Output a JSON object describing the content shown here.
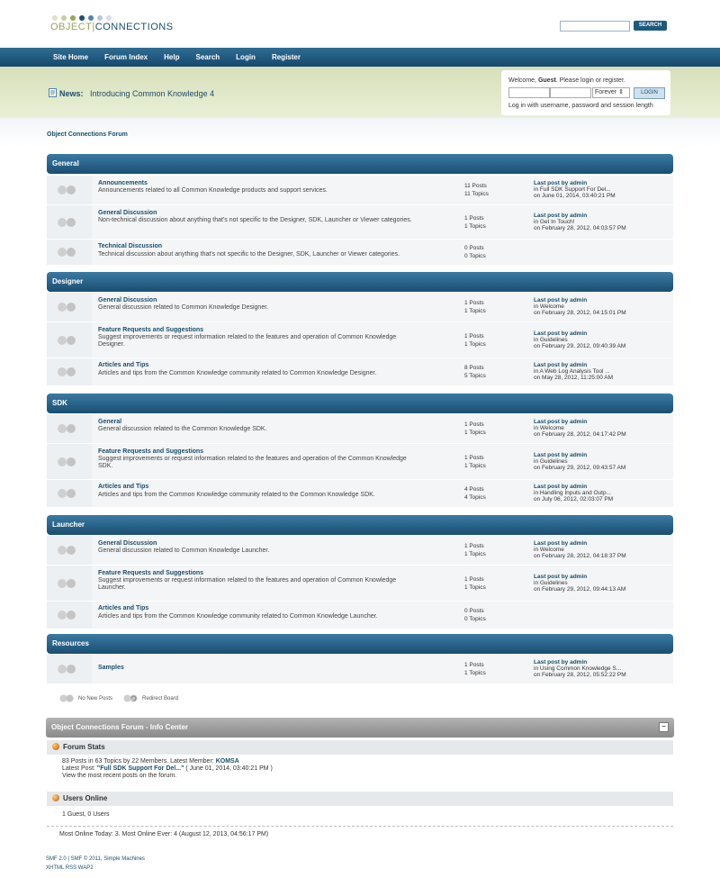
{
  "header": {
    "logo_part1": "OBJECT",
    "logo_sep": "|",
    "logo_part2": "CONNECTIONS",
    "logo_dot_colors": [
      "#dfe0c6",
      "#c8cda0",
      "#9aa45a",
      "#1b4d6b",
      "#4f86a8",
      "#b7c9d6",
      "#d6dee6"
    ],
    "search_value": "",
    "search_button": "SEARCH"
  },
  "nav": [
    "Site Home",
    "Forum Index",
    "Help",
    "Search",
    "Login",
    "Register"
  ],
  "news": {
    "label": "News:",
    "text": "Introducing Common Knowledge 4"
  },
  "login": {
    "welcome_prefix": "Welcome,",
    "welcome_user": "Guest",
    "welcome_suffix": ". Please login or register.",
    "duration": "Forever",
    "button": "LOGIN",
    "hint": "Log in with username, password and session length"
  },
  "breadcrumb": "Object Connections Forum",
  "categories": [
    {
      "name": "General",
      "boards": [
        {
          "name": "Announcements",
          "desc": "Announcements related to all Common Knowledge products and support services.",
          "posts": "11 Posts",
          "topics": "11 Topics",
          "lp1": "Last post by admin",
          "lp2": "in Full SDK Support For Del...",
          "lp3": "on June 01, 2014, 03:40:21 PM"
        },
        {
          "name": "General Discussion",
          "desc": "Non-technical discussion about anything that's not specific to the Designer, SDK, Launcher or Viewer categories.",
          "posts": "1 Posts",
          "topics": "1 Topics",
          "lp1": "Last post by admin",
          "lp2": "in Get In Touch!",
          "lp3": "on February 28, 2012, 04:03:57 PM"
        },
        {
          "name": "Technical Discussion",
          "desc": "Technical discussion about anything that's not specific to the Designer, SDK, Launcher or Viewer categories.",
          "posts": "0 Posts",
          "topics": "0 Topics",
          "lp1": "",
          "lp2": "",
          "lp3": ""
        }
      ]
    },
    {
      "name": "Designer",
      "boards": [
        {
          "name": "General Discussion",
          "desc": "General discussion related to Common Knowledge Designer.",
          "posts": "1 Posts",
          "topics": "1 Topics",
          "lp1": "Last post by admin",
          "lp2": "in Welcome",
          "lp3": "on February 28, 2012, 04:15:01 PM"
        },
        {
          "name": "Feature Requests and Suggestions",
          "desc": "Suggest improvements or request information related to the features and operation of Common Knowledge Designer.",
          "posts": "1 Posts",
          "topics": "1 Topics",
          "lp1": "Last post by admin",
          "lp2": "in Guidelines",
          "lp3": "on February 29, 2012, 09:40:39 AM"
        },
        {
          "name": "Articles and Tips",
          "desc": "Articles and tips from the Common Knowledge community related to Common Knowledge Designer.",
          "posts": "8 Posts",
          "topics": "5 Topics",
          "lp1": "Last post by admin",
          "lp2": "in A Web Log Analysis Tool ...",
          "lp3": "on May 28, 2012, 11:25:00 AM"
        }
      ]
    },
    {
      "name": "SDK",
      "boards": [
        {
          "name": "General",
          "desc": "General discussion related to the Common Knowledge SDK.",
          "posts": "1 Posts",
          "topics": "1 Topics",
          "lp1": "Last post by admin",
          "lp2": "in Welcome",
          "lp3": "on February 28, 2012, 04:17:42 PM"
        },
        {
          "name": "Feature Requests and Suggestions",
          "desc": "Suggest improvements or request information related to the features and operation of the Common Knowledge SDK.",
          "posts": "1 Posts",
          "topics": "1 Topics",
          "lp1": "Last post by admin",
          "lp2": "in Guidelines",
          "lp3": "on February 29, 2012, 09:43:57 AM"
        },
        {
          "name": "Articles and Tips",
          "desc": "Articles and tips from the Common Knowledge community related to the Common Knowledge SDK.",
          "posts": "4 Posts",
          "topics": "4 Topics",
          "lp1": "Last post by admin",
          "lp2": "in Handling Inputs and Outp...",
          "lp3": "on July 06, 2012, 02:03:07 PM"
        }
      ]
    },
    {
      "name": "Launcher",
      "boards": [
        {
          "name": "General Discussion",
          "desc": "General discussion related to Common Knowledge Launcher.",
          "posts": "1 Posts",
          "topics": "1 Topics",
          "lp1": "Last post by admin",
          "lp2": "in Welcome",
          "lp3": "on February 28, 2012, 04:18:37 PM"
        },
        {
          "name": "Feature Requests and Suggestions",
          "desc": "Suggest improvements or request information related to the features and operation of Common Knowledge Launcher.",
          "posts": "1 Posts",
          "topics": "1 Topics",
          "lp1": "Last post by admin",
          "lp2": "in Guidelines",
          "lp3": "on February 29, 2012, 09:44:13 AM"
        },
        {
          "name": "Articles and Tips",
          "desc": "Articles and tips from the Common Knowledge community related to Common Knowledge Launcher.",
          "posts": "0 Posts",
          "topics": "0 Topics",
          "lp1": "",
          "lp2": "",
          "lp3": ""
        }
      ]
    },
    {
      "name": "Resources",
      "boards": [
        {
          "name": "Samples",
          "desc": "",
          "posts": "1 Posts",
          "topics": "1 Topics",
          "lp1": "Last post by admin",
          "lp2": "in Using Common Knowledge S...",
          "lp3": "on February 28, 2012, 05:52:22 PM"
        }
      ]
    }
  ],
  "legend": {
    "no_new": "No New Posts",
    "redirect": "Redirect Board"
  },
  "info": {
    "title": "Object Connections Forum - Info Center",
    "collapse": "−",
    "stats_title": "Forum Stats",
    "stats_line1_prefix": "83 Posts in 63 Topics by 22 Members. Latest Member:",
    "stats_latest_member": "KOMSA",
    "stats_line2_prefix": "Latest Post:",
    "stats_latest_post": "\"Full SDK Support For Del...\"",
    "stats_line2_suffix": "( June 01, 2014, 03:40:21 PM )",
    "stats_line3": "View the most recent posts on the forum.",
    "online_title": "Users Online",
    "online_line": "1 Guest, 0 Users",
    "most_online": "Most Online Today: 3. Most Online Ever: 4 (August 12, 2013, 04:56:17 PM)"
  },
  "footer": {
    "line1": "SMF 2.0 | SMF © 2011, Simple Machines",
    "line2": "XHTML   RSS   WAP2"
  }
}
